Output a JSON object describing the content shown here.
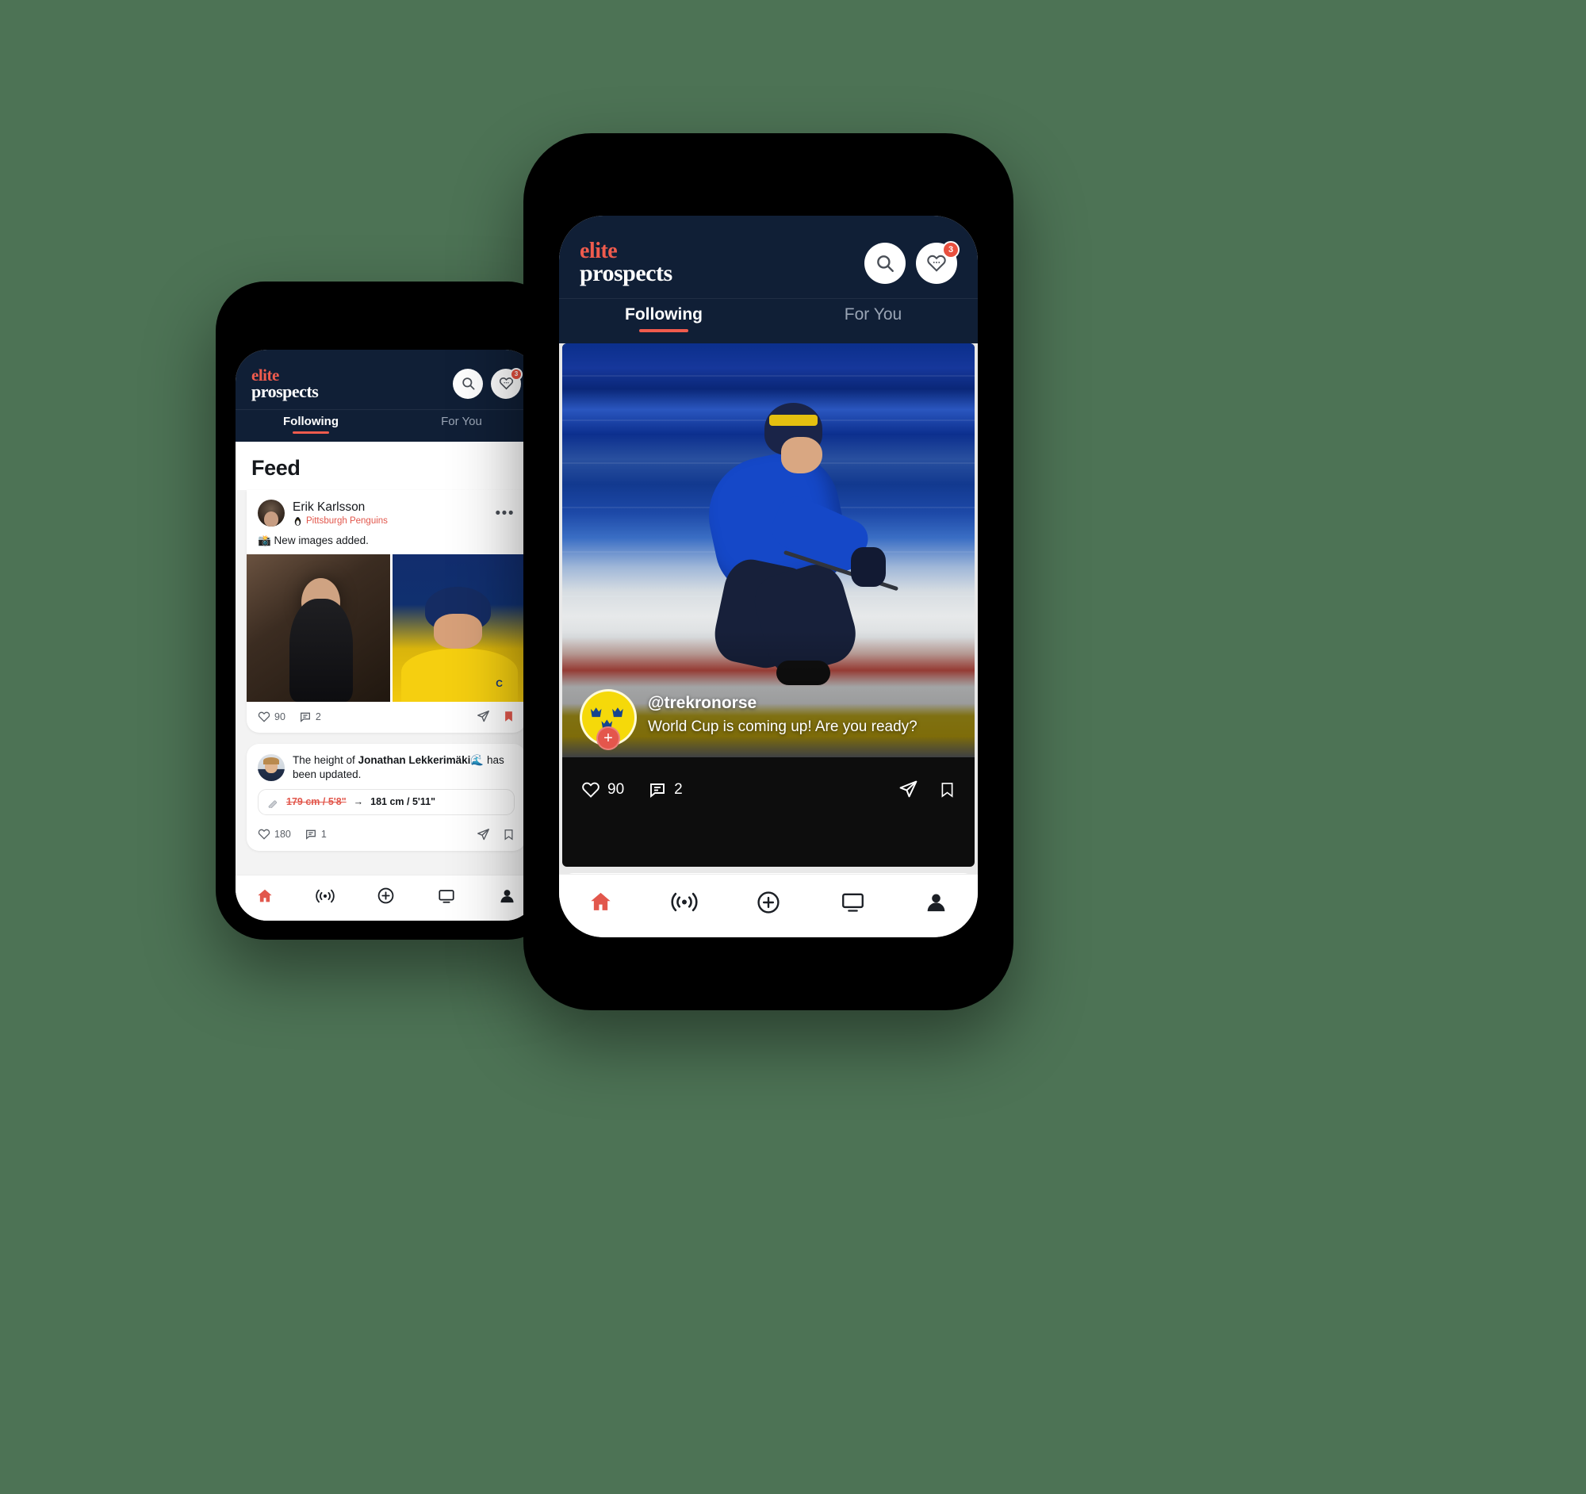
{
  "brand": {
    "logo_line1": "elite",
    "logo_line2": "prospects",
    "accent": "#ef5b4d",
    "header_bg": "#101f36"
  },
  "phone_small": {
    "header": {
      "search_icon": "search-icon",
      "notifications_icon": "heart-notification-icon",
      "notifications_badge": "3"
    },
    "tabs": [
      {
        "label": "Following",
        "active": true
      },
      {
        "label": "For You",
        "active": false
      }
    ],
    "feed_title": "Feed",
    "posts": [
      {
        "author": "Erik Karlsson",
        "team": "Pittsburgh Penguins",
        "team_logo_icon": "penguins-logo-icon",
        "more_icon": "more-options-icon",
        "text": "📸 New images added.",
        "likes": "90",
        "comments": "2",
        "share_icon": "share-icon",
        "bookmark_icon": "bookmark-filled-icon"
      },
      {
        "text_prefix": "The height of ",
        "player": "Jonathan Lekkerimäki",
        "player_team_icon": "🌊",
        "text_suffix": " has been updated.",
        "update_icon": "ruler-icon",
        "old_value": "179 cm / 5'8\"",
        "arrow": "→",
        "new_value": "181 cm / 5'11\"",
        "likes": "180",
        "comments": "1",
        "share_icon": "share-icon",
        "bookmark_icon": "bookmark-icon"
      }
    ],
    "bottom_nav": [
      {
        "icon": "home-icon",
        "active": true
      },
      {
        "icon": "live-broadcast-icon",
        "active": false
      },
      {
        "icon": "add-circle-icon",
        "active": false
      },
      {
        "icon": "screen-monitor-icon",
        "active": false
      },
      {
        "icon": "profile-icon",
        "active": false
      }
    ]
  },
  "phone_large": {
    "header": {
      "search_icon": "search-icon",
      "notifications_icon": "heart-notification-icon",
      "notifications_badge": "3"
    },
    "tabs": [
      {
        "label": "Following",
        "active": true
      },
      {
        "label": "For You",
        "active": false
      }
    ],
    "story": {
      "avatar_icon": "three-crowns-sweden-avatar",
      "follow_badge": "+",
      "username": "@trekronorse",
      "caption": "World Cup is coming up! Are you ready?",
      "likes": "90",
      "comments": "2",
      "share_icon": "share-icon",
      "bookmark_icon": "bookmark-icon"
    },
    "bottom_nav": [
      {
        "icon": "home-icon",
        "active": true
      },
      {
        "icon": "live-broadcast-icon",
        "active": false
      },
      {
        "icon": "add-circle-icon",
        "active": false
      },
      {
        "icon": "screen-monitor-icon",
        "active": false
      },
      {
        "icon": "profile-icon",
        "active": false
      }
    ]
  }
}
